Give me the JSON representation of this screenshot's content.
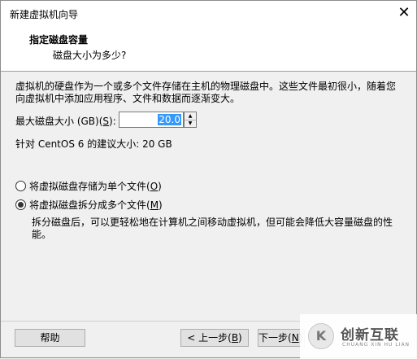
{
  "window": {
    "title": "新建虚拟机向导",
    "close_symbol": "✕"
  },
  "header": {
    "title": "指定磁盘容量",
    "subtitle": "磁盘大小为多少?"
  },
  "body": {
    "description_line1": "虚拟机的硬盘作为一个或多个文件存储在主机的物理磁盘中。这些文件最初很小，随着您",
    "description_line2": "向虚拟机中添加应用程序、文件和数据而逐渐变大。",
    "max_size_label_pre": "最大磁盘大小 (GB)(",
    "max_size_label_key": "S",
    "max_size_label_post": "):",
    "max_size_value": "20.0",
    "recommended_text": "针对 CentOS 6 的建议大小: 20 GB",
    "option_single": {
      "pre": "将虚拟磁盘存储为单个文件(",
      "key": "O",
      "post": ")",
      "selected": false
    },
    "option_split": {
      "pre": "将虚拟磁盘拆分成多个文件(",
      "key": "M",
      "post": ")",
      "selected": true
    },
    "split_note_line1": "拆分磁盘后，可以更轻松地在计算机之间移动虚拟机，但可能会降低大容量磁盘的性",
    "split_note_line2": "能。"
  },
  "footer": {
    "help_label": "帮助",
    "back_pre": "< 上一步(",
    "back_key": "B",
    "back_post": ")",
    "next_pre": "下一步(",
    "next_key": "N",
    "next_post": ") >"
  },
  "watermark": {
    "logo_letter": "K",
    "title": "创新互联",
    "subtitle": "CHUANG XIN HU LIAN"
  },
  "colors": {
    "selection": "#3399ff",
    "header_bg": "#ffffff",
    "dialog_bg": "#f0f0f0"
  }
}
